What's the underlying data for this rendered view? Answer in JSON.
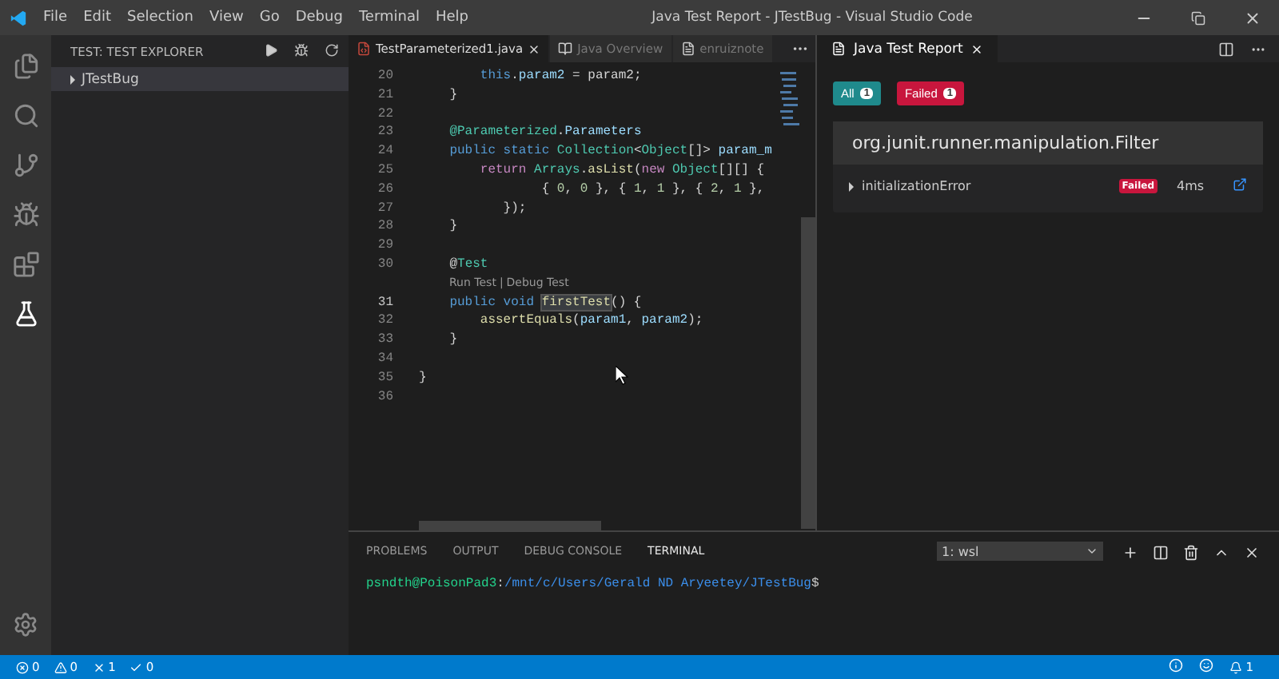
{
  "window": {
    "title": "Java Test Report - JTestBug - Visual Studio Code"
  },
  "menu": [
    "File",
    "Edit",
    "Selection",
    "View",
    "Go",
    "Debug",
    "Terminal",
    "Help"
  ],
  "activity_bar": [
    {
      "kind": "files",
      "selected": false
    },
    {
      "kind": "search",
      "selected": false
    },
    {
      "kind": "scm",
      "selected": false
    },
    {
      "kind": "debug",
      "selected": false
    },
    {
      "kind": "extensions",
      "selected": false
    },
    {
      "kind": "test",
      "selected": true
    }
  ],
  "sidebar": {
    "title": "TEST: TEST EXPLORER",
    "items": [
      {
        "label": "JTestBug",
        "expanded": false
      }
    ]
  },
  "editor": {
    "tabs": [
      {
        "label": "TestParameterized1.java",
        "kind": "java",
        "selected": true
      },
      {
        "label": "Java Overview",
        "kind": "overview",
        "selected": false
      },
      {
        "label": "enruiznote",
        "kind": "file",
        "selected": false
      }
    ],
    "lines": [
      {
        "number": "20",
        "tokens": [
          {
            "t": "        this",
            "kind": "kw"
          },
          {
            "t": "."
          },
          {
            "t": "param2",
            "kind": "var"
          },
          {
            "t": " = param2;"
          }
        ]
      },
      {
        "number": "21",
        "tokens": [
          {
            "t": "    }"
          }
        ]
      },
      {
        "number": "22"
      },
      {
        "number": "23",
        "tokens": [
          {
            "t": "    @Parameterized",
            "kind": "type"
          },
          {
            "t": "."
          },
          {
            "t": "Parameters",
            "kind": "var"
          }
        ]
      },
      {
        "number": "24",
        "tokens": [
          {
            "t": "    public static ",
            "kind": "kw"
          },
          {
            "t": "Collection",
            "kind": "type"
          },
          {
            "t": "<"
          },
          {
            "t": "Object",
            "kind": "type"
          },
          {
            "t": "[]> "
          },
          {
            "t": "param_m",
            "kind": "var"
          }
        ]
      },
      {
        "number": "25",
        "tokens": [
          {
            "t": "        return ",
            "kind": "ctl"
          },
          {
            "t": "Arrays",
            "kind": "type"
          },
          {
            "t": "."
          },
          {
            "t": "asList",
            "kind": "fn"
          },
          {
            "t": "("
          },
          {
            "t": "new ",
            "kind": "ctl"
          },
          {
            "t": "Object",
            "kind": "type"
          },
          {
            "t": "[][] {"
          }
        ]
      },
      {
        "number": "26",
        "tokens": [
          {
            "t": "                { "
          },
          {
            "t": "0",
            "kind": "num"
          },
          {
            "t": ", "
          },
          {
            "t": "0",
            "kind": "num"
          },
          {
            "t": " }, { "
          },
          {
            "t": "1",
            "kind": "num"
          },
          {
            "t": ", "
          },
          {
            "t": "1",
            "kind": "num"
          },
          {
            "t": " }, { "
          },
          {
            "t": "2",
            "kind": "num"
          },
          {
            "t": ", "
          },
          {
            "t": "1",
            "kind": "num"
          },
          {
            "t": " },"
          }
        ]
      },
      {
        "number": "27",
        "tokens": [
          {
            "t": "           });"
          }
        ]
      },
      {
        "number": "28",
        "tokens": [
          {
            "t": "    }"
          }
        ]
      },
      {
        "number": "29"
      },
      {
        "number": "30",
        "tokens": [
          {
            "t": "    @"
          },
          {
            "t": "Test",
            "kind": "type"
          }
        ]
      },
      {
        "kind": "lens",
        "links": [
          "Run Test",
          "Debug Test"
        ],
        "separator": "|"
      },
      {
        "number": "31",
        "current": true,
        "tokens": [
          {
            "t": "    public void ",
            "kind": "kw"
          },
          {
            "t": "firstTest",
            "kind": "fn",
            "highlight": true
          },
          {
            "t": "() {"
          }
        ]
      },
      {
        "number": "32",
        "tokens": [
          {
            "t": "        assertEquals",
            "kind": "fn"
          },
          {
            "t": "("
          },
          {
            "t": "param1",
            "kind": "var"
          },
          {
            "t": ", "
          },
          {
            "t": "param2",
            "kind": "var"
          },
          {
            "t": ");"
          }
        ]
      },
      {
        "number": "33",
        "tokens": [
          {
            "t": "    }"
          }
        ]
      },
      {
        "number": "34"
      },
      {
        "number": "35",
        "tokens": [
          {
            "t": "}"
          }
        ]
      },
      {
        "number": "36"
      }
    ]
  },
  "report": {
    "tab": "Java Test Report",
    "filters": [
      {
        "label": "All",
        "count": "1",
        "color": "#1f8a8c"
      },
      {
        "label": "Failed",
        "count": "1",
        "color": "#c8163d"
      }
    ],
    "suite": "org.junit.runner.manipulation.Filter",
    "tests": [
      {
        "name": "initializationError",
        "status": "Failed",
        "duration": "4ms",
        "expanded": false
      }
    ]
  },
  "panel": {
    "tabs": [
      {
        "label": "PROBLEMS",
        "selected": false
      },
      {
        "label": "OUTPUT",
        "selected": false
      },
      {
        "label": "DEBUG CONSOLE",
        "selected": false
      },
      {
        "label": "TERMINAL",
        "selected": true
      }
    ],
    "terminal_select": "1: wsl",
    "prompt": [
      {
        "t": "psndth@PoisonPad3",
        "kind": "user"
      },
      {
        "t": ":"
      },
      {
        "t": "/mnt/c/Users/Gerald ND Aryeetey/JTestBug",
        "kind": "path"
      },
      {
        "t": "$"
      }
    ]
  },
  "status_bar": {
    "errors": "0",
    "warnings": "0",
    "failed": "1",
    "passed": "0",
    "notifications": "1"
  }
}
